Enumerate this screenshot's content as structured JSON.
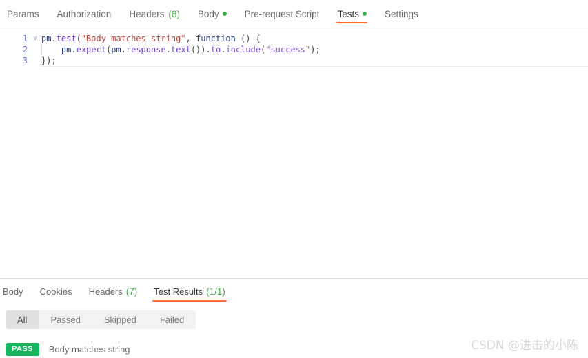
{
  "request_tabs": [
    {
      "label": "Params",
      "count": "",
      "dot": false,
      "active": false
    },
    {
      "label": "Authorization",
      "count": "",
      "dot": false,
      "active": false
    },
    {
      "label": "Headers",
      "count": "(8)",
      "dot": false,
      "active": false
    },
    {
      "label": "Body",
      "count": "",
      "dot": true,
      "active": false
    },
    {
      "label": "Pre-request Script",
      "count": "",
      "dot": false,
      "active": false
    },
    {
      "label": "Tests",
      "count": "",
      "dot": true,
      "active": true
    },
    {
      "label": "Settings",
      "count": "",
      "dot": false,
      "active": false
    }
  ],
  "editor": {
    "lines": [
      {
        "number": "1",
        "fold": "∨",
        "indented": false,
        "tokens": [
          {
            "text": "pm",
            "style": "tok-obj"
          },
          {
            "text": ".",
            "style": "tok-punc"
          },
          {
            "text": "test",
            "style": "tok-prop"
          },
          {
            "text": "(",
            "style": "tok-punc"
          },
          {
            "text": "\"Body matches string\"",
            "style": "tok-str-red"
          },
          {
            "text": ", ",
            "style": "tok-punc"
          },
          {
            "text": "function",
            "style": "tok-kw"
          },
          {
            "text": " () {",
            "style": "tok-punc"
          }
        ]
      },
      {
        "number": "2",
        "fold": "",
        "indented": true,
        "tokens": [
          {
            "text": "    pm",
            "style": "tok-obj"
          },
          {
            "text": ".",
            "style": "tok-punc"
          },
          {
            "text": "expect",
            "style": "tok-prop"
          },
          {
            "text": "(",
            "style": "tok-punc"
          },
          {
            "text": "pm",
            "style": "tok-obj"
          },
          {
            "text": ".",
            "style": "tok-punc"
          },
          {
            "text": "response",
            "style": "tok-prop"
          },
          {
            "text": ".",
            "style": "tok-punc"
          },
          {
            "text": "text",
            "style": "tok-prop"
          },
          {
            "text": "())",
            "style": "tok-punc"
          },
          {
            "text": ".",
            "style": "tok-punc"
          },
          {
            "text": "to",
            "style": "tok-prop"
          },
          {
            "text": ".",
            "style": "tok-punc"
          },
          {
            "text": "include",
            "style": "tok-prop"
          },
          {
            "text": "(",
            "style": "tok-punc"
          },
          {
            "text": "\"success\"",
            "style": "tok-str-purple"
          },
          {
            "text": ");",
            "style": "tok-punc"
          }
        ]
      },
      {
        "number": "3",
        "fold": "",
        "indented": false,
        "tokens": [
          {
            "text": "});",
            "style": "tok-punc"
          }
        ]
      }
    ]
  },
  "response_tabs": [
    {
      "label": "Body",
      "count": "",
      "active": false
    },
    {
      "label": "Cookies",
      "count": "",
      "active": false
    },
    {
      "label": "Headers",
      "count": "(7)",
      "active": false
    },
    {
      "label": "Test Results",
      "count": "(1/1)",
      "active": true
    }
  ],
  "filters": [
    {
      "label": "All",
      "active": true
    },
    {
      "label": "Passed",
      "active": false
    },
    {
      "label": "Skipped",
      "active": false
    },
    {
      "label": "Failed",
      "active": false
    }
  ],
  "test_results": [
    {
      "status": "PASS",
      "name": "Body matches string"
    }
  ],
  "watermark": "CSDN @进击的小陈",
  "colors": {
    "accent": "#ff6c37",
    "pass_green": "#17b55f",
    "count_green": "#4caf50",
    "dot_green": "#37b24d"
  }
}
